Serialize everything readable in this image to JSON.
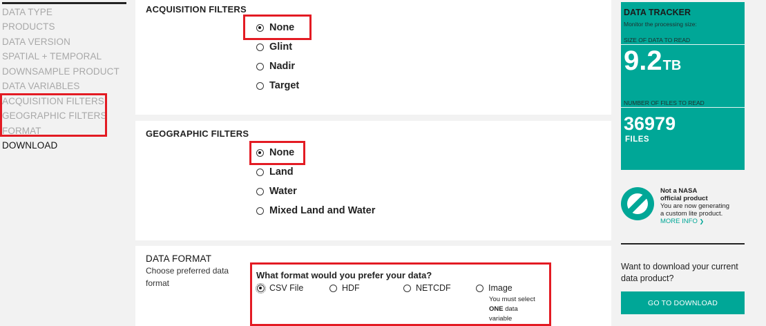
{
  "nav": {
    "items": [
      {
        "label": "DATA TYPE",
        "active": false
      },
      {
        "label": "PRODUCTS",
        "active": false
      },
      {
        "label": "DATA VERSION",
        "active": false
      },
      {
        "label": "SPATIAL + TEMPORAL",
        "active": false
      },
      {
        "label": "DOWNSAMPLE PRODUCT",
        "active": false
      },
      {
        "label": "DATA VARIABLES",
        "active": false
      },
      {
        "label": "ACQUISITION FILTERS",
        "active": false
      },
      {
        "label": "GEOGRAPHIC FILTERS",
        "active": false
      },
      {
        "label": "FORMAT",
        "active": false
      },
      {
        "label": "DOWNLOAD",
        "active": true
      }
    ]
  },
  "acquisition": {
    "title": "ACQUISITION FILTERS",
    "selected": "None",
    "options": [
      "None",
      "Glint",
      "Nadir",
      "Target"
    ]
  },
  "geographic": {
    "title": "GEOGRAPHIC FILTERS",
    "selected": "None",
    "options": [
      "None",
      "Land",
      "Water",
      "Mixed Land and Water"
    ]
  },
  "format": {
    "title": "DATA FORMAT",
    "description_line1": "Choose preferred data",
    "description_line2": "format",
    "question": "What format would you prefer your data?",
    "selected": "CSV File",
    "options": [
      "CSV File",
      "HDF",
      "NETCDF",
      "Image"
    ],
    "image_note_line1": "You must select",
    "image_note_bold": "ONE",
    "image_note_line2b": " data",
    "image_note_line3": "variable"
  },
  "tracker": {
    "title": "DATA TRACKER",
    "subtitle": "Monitor the processing size:",
    "size_label": "SIZE OF DATA TO READ",
    "size_value": "9.2",
    "size_unit": "TB",
    "files_label": "NUMBER OF FILES TO READ",
    "files_value": "36979",
    "files_unit": "FILES"
  },
  "nasa_notice": {
    "line1": "Not a NASA",
    "line2": "official product",
    "line3": "You are now generating",
    "line4": "a custom lite product.",
    "more_info": "MORE INFO",
    "more_info_arrow": "❯"
  },
  "download": {
    "question": "Want to download your current data product?",
    "button": "GO TO DOWNLOAD"
  },
  "colors": {
    "accent": "#00a797",
    "highlight_box": "#e31b23"
  }
}
